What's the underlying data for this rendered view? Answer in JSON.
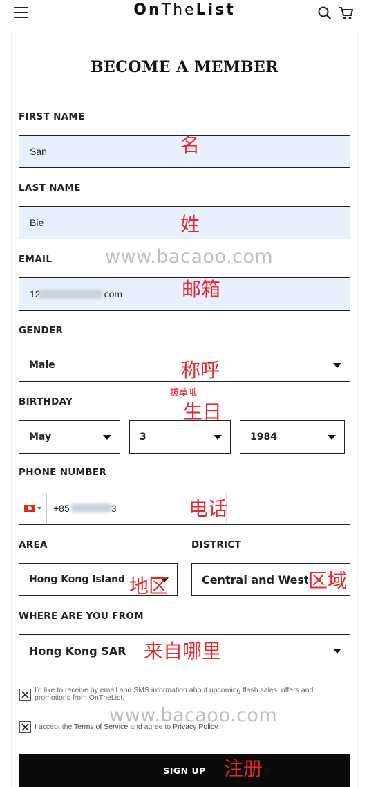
{
  "header": {
    "logo_part1": "On",
    "logo_part2": "The",
    "logo_part3": "List",
    "icons": [
      "hamburger-menu-icon",
      "search-icon",
      "cart-icon"
    ]
  },
  "page": {
    "title": "BECOME A MEMBER"
  },
  "form": {
    "first_name": {
      "label": "FIRST NAME",
      "value": "San"
    },
    "last_name": {
      "label": "LAST NAME",
      "value": "Bie"
    },
    "email": {
      "label": "EMAIL",
      "value_start": "12",
      "value_end": "com"
    },
    "gender": {
      "label": "GENDER",
      "selected": "Male"
    },
    "birthday": {
      "label": "BIRTHDAY",
      "month": "May",
      "day": "3",
      "year": "1984"
    },
    "phone": {
      "label": "PHONE NUMBER",
      "value_start": "+85",
      "value_end": "3",
      "country_flag": "hong-kong-flag-icon"
    },
    "area": {
      "label": "AREA",
      "selected": "Hong Kong Island"
    },
    "district": {
      "label": "DISTRICT",
      "selected": "Central and Western"
    },
    "origin": {
      "label": "WHERE ARE YOU FROM",
      "selected": "Hong Kong SAR"
    },
    "consent_marketing": "I'd like to receive by email and SMS information about upcoming flash sales, offers and promotions from OnTheList.",
    "consent_terms_prefix": "I accept the",
    "terms_link": "Terms of Service",
    "consent_terms_middle": "and agree to",
    "privacy_link": "Privacy Policy",
    "consent_terms_suffix": ".",
    "submit_label": "SIGN UP"
  },
  "annotations": {
    "first_name": "名",
    "last_name": "姓",
    "email": "邮箱",
    "gender": "称呼",
    "credit": "拔草哦",
    "birthday": "生日",
    "phone": "电话",
    "area": "地区",
    "district": "区域",
    "origin": "来自哪里",
    "submit": "注册"
  },
  "watermarks": {
    "top": "www.bacaoo.com",
    "bottom": "www.bacaoo.com"
  },
  "colors": {
    "annotation": "#e8262b",
    "autofill": "#e8f0fe",
    "button": "#0a0a0a"
  }
}
